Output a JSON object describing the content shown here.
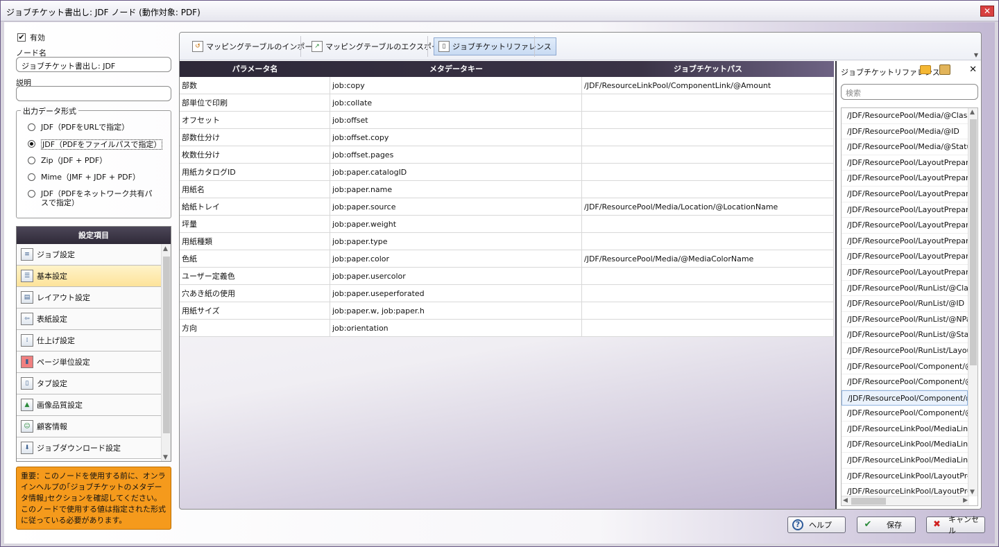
{
  "window": {
    "title": "ジョブチケット書出し: JDF ノード (動作対象: PDF)"
  },
  "left": {
    "enabled_label": "有効",
    "enabled_checked": "✔",
    "node_name_label": "ノード名",
    "node_name_value": "ジョブチケット書出し: JDF",
    "description_label": "説明",
    "description_value": "",
    "output_group_title": "出力データ形式",
    "output_options": [
      "JDF（PDFをURLで指定）",
      "JDF（PDFをファイルパスで指定）",
      "Zip（JDF + PDF）",
      "Mime（JMF + JDF + PDF）",
      "JDF（PDFをネットワーク共有パスで指定）"
    ],
    "settings_title": "設定項目",
    "settings_items": [
      "ジョブ設定",
      "基本設定",
      "レイアウト設定",
      "表紙設定",
      "仕上げ設定",
      "ページ単位設定",
      "タブ設定",
      "画像品質設定",
      "顧客情報",
      "ジョブダウンロード設定"
    ],
    "note": "重要：このノードを使用する前に、オンラインヘルプの｢ジョブチケットのメタデータ情報｣セクションを確認してください。このノードで使用する値は指定された形式に従っている必要があります。"
  },
  "toolbar": {
    "import_label": "マッピングテーブルのインポート",
    "export_label": "マッピングテーブルのエクスポート",
    "reference_label": "ジョブチケットリファレンス"
  },
  "table": {
    "headers": [
      "パラメータ名",
      "メタデータキー",
      "ジョブチケットパス"
    ],
    "rows": [
      [
        "部数",
        "job:copy",
        "/JDF/ResourceLinkPool/ComponentLink/@Amount"
      ],
      [
        "部単位で印刷",
        "job:collate",
        ""
      ],
      [
        "オフセット",
        "job:offset",
        ""
      ],
      [
        "部数仕分け",
        "job:offset.copy",
        ""
      ],
      [
        "枚数仕分け",
        "job:offset.pages",
        ""
      ],
      [
        "用紙カタログID",
        "job:paper.catalogID",
        ""
      ],
      [
        "用紙名",
        "job:paper.name",
        ""
      ],
      [
        "給紙トレイ",
        "job:paper.source",
        "/JDF/ResourcePool/Media/Location/@LocationName"
      ],
      [
        "坪量",
        "job:paper.weight",
        ""
      ],
      [
        "用紙種類",
        "job:paper.type",
        ""
      ],
      [
        "色紙",
        "job:paper.color",
        "/JDF/ResourcePool/Media/@MediaColorName"
      ],
      [
        "ユーザー定義色",
        "job:paper.usercolor",
        ""
      ],
      [
        "穴あき紙の使用",
        "job:paper.useperforated",
        ""
      ],
      [
        "用紙サイズ",
        "job:paper.w, job:paper.h",
        ""
      ],
      [
        "方向",
        "job:orientation",
        ""
      ]
    ]
  },
  "reference": {
    "title": "ジョブチケットリファレンス",
    "search_placeholder": "検索",
    "items": [
      "/JDF/ResourcePool/Media/@Class",
      "/JDF/ResourcePool/Media/@ID",
      "/JDF/ResourcePool/Media/@Statu",
      "/JDF/ResourcePool/LayoutPrepara",
      "/JDF/ResourcePool/LayoutPrepara",
      "/JDF/ResourcePool/LayoutPrepara",
      "/JDF/ResourcePool/LayoutPrepara",
      "/JDF/ResourcePool/LayoutPrepara",
      "/JDF/ResourcePool/LayoutPrepara",
      "/JDF/ResourcePool/LayoutPrepara",
      "/JDF/ResourcePool/LayoutPrepara",
      "/JDF/ResourcePool/RunList/@Clas",
      "/JDF/ResourcePool/RunList/@ID",
      "/JDF/ResourcePool/RunList/@NPa",
      "/JDF/ResourcePool/RunList/@Stat",
      "/JDF/ResourcePool/RunList/Layou",
      "/JDF/ResourcePool/Component/@",
      "/JDF/ResourcePool/Component/@",
      "/JDF/ResourcePool/Component/@",
      "/JDF/ResourcePool/Component/@",
      "/JDF/ResourceLinkPool/MediaLink",
      "/JDF/ResourceLinkPool/MediaLink",
      "/JDF/ResourceLinkPool/MediaLink",
      "/JDF/ResourceLinkPool/LayoutPre",
      "/JDF/ResourceLinkPool/LayoutPre"
    ]
  },
  "footer": {
    "help_label": "ヘルプ",
    "save_label": "保存",
    "cancel_label": "キャンセル"
  },
  "colors": {
    "accent": "#2f2a38",
    "note_bg": "#f59a1c",
    "selected_item": "#fde39a"
  },
  "icons": [
    "checkbox-icon",
    "import-icon",
    "export-icon",
    "reference-icon",
    "open-folder-icon",
    "delete-icon",
    "close-icon",
    "help-icon",
    "check-icon",
    "cancel-icon"
  ]
}
